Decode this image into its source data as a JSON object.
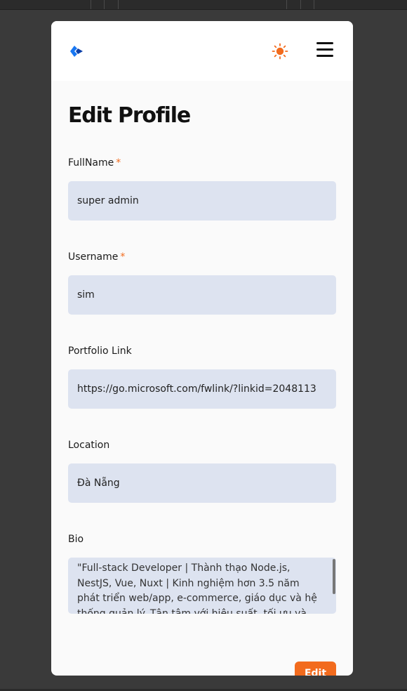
{
  "page": {
    "title": "Edit Profile"
  },
  "header": {
    "logo_icon": "brand-logo-icon",
    "theme_icon": "sun-icon",
    "menu_icon": "hamburger-menu-icon"
  },
  "form": {
    "fullname": {
      "label": "FullName",
      "required": "*",
      "value": "super admin"
    },
    "username": {
      "label": "Username",
      "required": "*",
      "value": "sim"
    },
    "portfolio": {
      "label": "Portfolio Link",
      "value": "https://go.microsoft.com/fwlink/?linkid=2048113"
    },
    "location": {
      "label": "Location",
      "value": "Đà Nẵng"
    },
    "bio": {
      "label": "Bio",
      "value": "\"Full-stack Developer | Thành thạo Node.js, NestJS, Vue, Nuxt | Kinh nghiệm hơn 3.5 năm phát triển web/app, e-commerce, giáo dục và hệ thống quản lý. Tận tâm với hiệu suất, tối ưu và giải pháp kỹ thuật"
    },
    "submit_label": "Edit"
  },
  "colors": {
    "accent": "#f26b1d",
    "input_bg": "#dde3f0",
    "logo_blue": "#1877f2"
  }
}
